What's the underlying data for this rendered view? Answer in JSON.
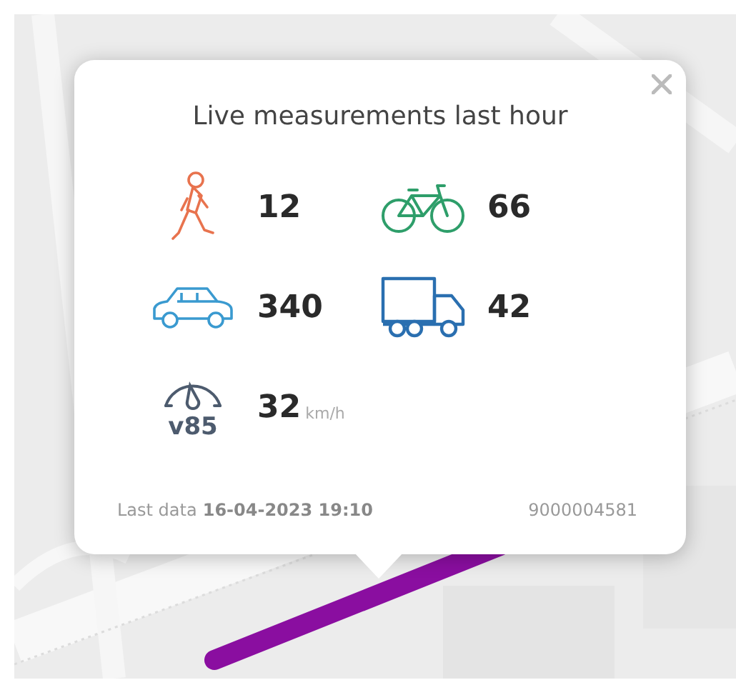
{
  "popup": {
    "title": "Live measurements last hour",
    "measurements": [
      {
        "kind": "pedestrian",
        "value": "12",
        "color": "#e8734e"
      },
      {
        "kind": "bicycle",
        "value": "66",
        "color": "#2e9e6a"
      },
      {
        "kind": "car",
        "value": "340",
        "color": "#3a9ad0"
      },
      {
        "kind": "truck",
        "value": "42",
        "color": "#2a6fb0"
      },
      {
        "kind": "speed",
        "value": "32",
        "unit": "km/h",
        "badge": "v85",
        "color": "#4d5b6e"
      }
    ],
    "footer": {
      "label": "Last data",
      "timestamp": "16-04-2023 19:10",
      "station_id": "9000004581"
    }
  }
}
